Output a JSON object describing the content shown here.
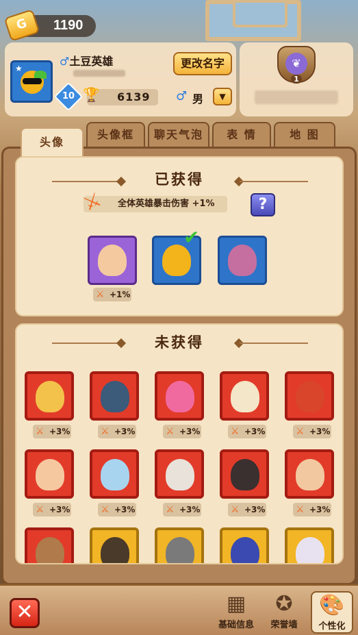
{
  "currency": {
    "icon": "gold-ticket-icon",
    "letter": "G",
    "value": "1190"
  },
  "profile": {
    "name": "土豆英雄",
    "gender_symbol": "♂",
    "level": "10",
    "trophies": "6139",
    "rename_label": "更改名字",
    "gender_label": "男",
    "dropdown_arrow": "▼"
  },
  "guild": {
    "badge_number": "1"
  },
  "tabs": [
    {
      "label": "头像"
    },
    {
      "label": "头像框"
    },
    {
      "label": "聊天气泡"
    },
    {
      "label": "表 情"
    },
    {
      "label": "地 图"
    }
  ],
  "obtained": {
    "title": "已获得",
    "bonus_text": "全体英雄暴击伤害 +1%",
    "help_label": "?",
    "avatars": [
      {
        "color": "purple",
        "bonus": "+1%"
      },
      {
        "color": "blue",
        "selected": true
      },
      {
        "color": "blue"
      }
    ]
  },
  "unobtained": {
    "title": "未获得",
    "rows": [
      [
        {
          "bonus": "+3%"
        },
        {
          "bonus": "+3%"
        },
        {
          "bonus": "+3%"
        },
        {
          "bonus": "+3%"
        },
        {
          "bonus": "+3%"
        }
      ],
      [
        {
          "bonus": "+3%"
        },
        {
          "bonus": "+3%"
        },
        {
          "bonus": "+3%"
        },
        {
          "bonus": "+3%"
        },
        {
          "bonus": "+3%"
        }
      ]
    ]
  },
  "bottom_nav": {
    "close_label": "✕",
    "items": [
      {
        "label": "基础信息",
        "icon": "blocks-icon"
      },
      {
        "label": "荣誉墙",
        "icon": "medal-icon"
      },
      {
        "label": "个性化",
        "icon": "palette-icon",
        "active": true
      }
    ]
  }
}
